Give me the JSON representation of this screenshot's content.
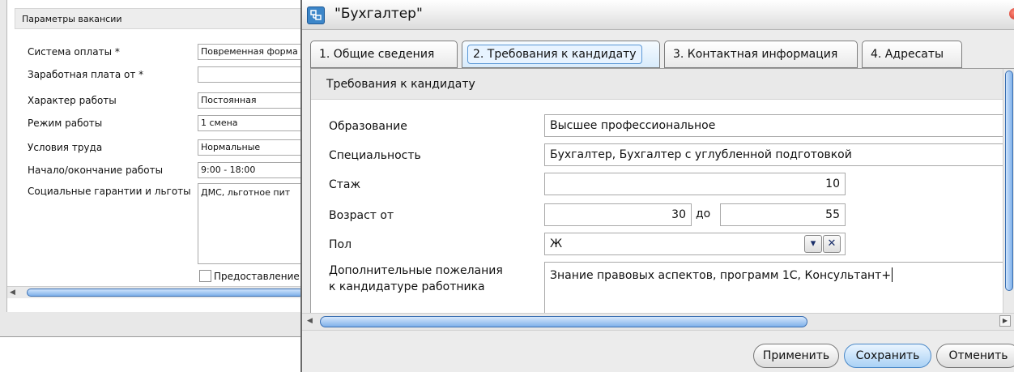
{
  "background_form": {
    "header": "Параметры вакансии",
    "rows": [
      {
        "label": "Система оплаты *",
        "value": "Повременная форма"
      },
      {
        "label": "Заработная плата от *",
        "value": ""
      },
      {
        "label": "Характер работы",
        "value": "Постоянная"
      },
      {
        "label": "Режим работы",
        "value": "1 смена"
      },
      {
        "label": "Условия труда",
        "value": "Нормальные"
      },
      {
        "label": "Начало/окончание работы",
        "value": "9:00 - 18:00"
      },
      {
        "label": "Социальные гарантии и льготы",
        "value": "ДМС, льготное пит"
      }
    ],
    "checkbox_label": "Предоставление"
  },
  "dialog": {
    "title": "\"Бухгалтер\"",
    "tabs": [
      {
        "label": "1. Общие сведения"
      },
      {
        "label": "2. Требования к кандидату"
      },
      {
        "label": "3. Контактная информация"
      },
      {
        "label": "4. Адресаты"
      }
    ],
    "active_tab_index": 1,
    "section_title": "Требования к кандидату",
    "fields": {
      "education": {
        "label": "Образование",
        "value": "Высшее профессиональное"
      },
      "specialty": {
        "label": "Специальность",
        "value": "Бухгалтер, Бухгалтер с углубленной подготовкой"
      },
      "experience": {
        "label": "Стаж",
        "value": "10"
      },
      "age": {
        "label": "Возраст от",
        "from": "30",
        "to_label": "до",
        "to": "55"
      },
      "gender": {
        "label": "Пол",
        "value": "Ж"
      },
      "wishes": {
        "label_line1": "Дополнительные пожелания",
        "label_line2": "к кандидатуре работника",
        "value": "Знание правовых аспектов, программ 1С, Консультант+"
      }
    },
    "buttons": {
      "apply": "Применить",
      "save": "Сохранить",
      "cancel": "Отменить"
    }
  },
  "icons": {
    "dropdown": "▾",
    "clear": "✕",
    "scroll_left": "◀",
    "scroll_right": "▶"
  },
  "colors": {
    "accent": "#5a97d6",
    "scroll_thumb": "#7fb1ea"
  }
}
